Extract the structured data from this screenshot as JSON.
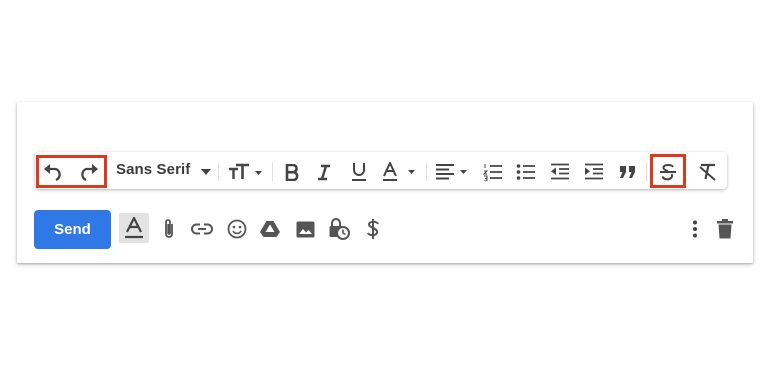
{
  "toolbar": {
    "font_family": "Sans Serif"
  },
  "compose": {
    "send_label": "Send"
  },
  "colors": {
    "highlight": "#db3a1f",
    "send_button": "#2f78e5",
    "icon": "#5f6368"
  },
  "icons": [
    "undo-icon",
    "redo-icon",
    "text-size-icon",
    "bold-icon",
    "italic-icon",
    "underline-icon",
    "text-color-icon",
    "align-icon",
    "numbered-list-icon",
    "bulleted-list-icon",
    "indent-less-icon",
    "indent-more-icon",
    "quote-icon",
    "strikethrough-icon",
    "remove-formatting-icon",
    "formatting-options-icon",
    "attach-icon",
    "link-icon",
    "emoji-icon",
    "drive-icon",
    "photo-icon",
    "confidential-icon",
    "money-icon",
    "more-options-icon",
    "trash-icon"
  ]
}
